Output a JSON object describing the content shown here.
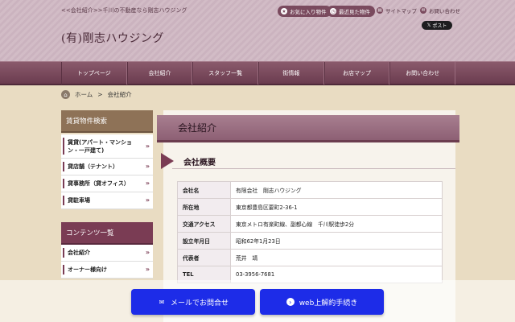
{
  "header": {
    "tagline": "<<会社紹介>>千川の不動産なら剛志ハウジング",
    "logo": "(有)剛志ハウジング",
    "favorites_label": "お気に入り物件",
    "recent_label": "最近見た物件",
    "sitemap_label": "サイトマップ",
    "contact_label": "お問い合わせ",
    "post_label": "ポスト"
  },
  "nav": {
    "items": [
      "トップページ",
      "会社紹介",
      "スタッフ一覧",
      "街情報",
      "お店マップ",
      "お問い合わせ"
    ]
  },
  "breadcrumb": {
    "home": "ホーム",
    "separator": ">",
    "current": "会社紹介"
  },
  "sidebar": {
    "search_heading": "賃貸物件検索",
    "search_items": [
      "賃貸(アパート・マンション・一戸建て)",
      "貸店舗（テナント）",
      "貸事務所（貸オフィス）",
      "貸駐車場"
    ],
    "content_heading": "コンテンツ一覧",
    "content_items": [
      "会社紹介",
      "オーナー様向け"
    ]
  },
  "main": {
    "title": "会社紹介",
    "section_title": "会社概要",
    "rows": [
      {
        "label": "会社名",
        "value": "有限会社　剛志ハウジング"
      },
      {
        "label": "所在地",
        "value": "東京都豊島区要町2-36-1"
      },
      {
        "label": "交通アクセス",
        "value": "東京メトロ有楽町線、副都心線　千川駅徒歩2分"
      },
      {
        "label": "設立年月日",
        "value": "昭和62年1月23日"
      },
      {
        "label": "代表者",
        "value": "荒井　靖"
      },
      {
        "label": "TEL",
        "value": "03-3956-7681"
      }
    ]
  },
  "cta": {
    "mail_label": "メールでお問合せ",
    "web_label": "web上解約手続き"
  },
  "colors": {
    "nav": "#7a4a5e",
    "accent": "#7a3c54",
    "cta": "#1d2ce8"
  }
}
